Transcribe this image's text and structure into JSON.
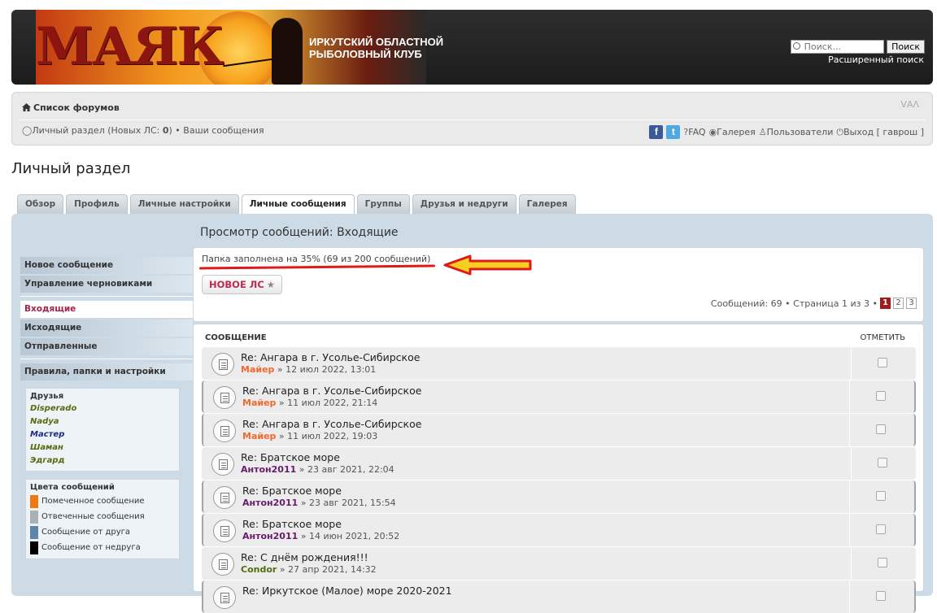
{
  "header": {
    "logo_text": "МАЯК",
    "club_line1": "Иркутский областной",
    "club_line2": "рыболовный клуб",
    "search_placeholder": "Поиск...",
    "search_button": "Поиск",
    "advanced_search": "Расширенный поиск"
  },
  "nav": {
    "forum_list": "Список форумов",
    "resize_icon": "ᐯAᐱ",
    "personal_section": "Личный раздел (Новых ЛС: ",
    "new_pm_count": "0",
    "personal_close": ")",
    "bullet": " • ",
    "your_posts": "Ваши сообщения",
    "faq": "FAQ",
    "gallery": "Галерея",
    "users": "Пользователи",
    "logout": "Выход [ гаврош ]",
    "facebook_glyph": "f",
    "twitter_glyph": "t"
  },
  "page": {
    "title": "Личный раздел",
    "tabs": [
      {
        "label": "Обзор",
        "active": false
      },
      {
        "label": "Профиль",
        "active": false
      },
      {
        "label": "Личные настройки",
        "active": false
      },
      {
        "label": "Личные сообщения",
        "active": true
      },
      {
        "label": "Группы",
        "active": false
      },
      {
        "label": "Друзья и недруги",
        "active": false
      },
      {
        "label": "Галерея",
        "active": false
      }
    ]
  },
  "sidebar": {
    "compose": "Новое сообщение",
    "drafts": "Управление черновиками",
    "inbox": "Входящие",
    "outbox": "Исходящие",
    "sent": "Отправленные",
    "rules": "Правила, папки и настройки",
    "friends_header": "Друзья",
    "friends": [
      {
        "name": "Disperado",
        "color": "#556b10"
      },
      {
        "name": "Nadya",
        "color": "#556b10"
      },
      {
        "name": "Мастер",
        "color": "#1a2a8a"
      },
      {
        "name": "Шаман",
        "color": "#556b10"
      },
      {
        "name": "Эдгард",
        "color": "#556b10"
      }
    ],
    "colors_header": "Цвета сообщений",
    "legend": [
      {
        "label": "Помеченное сообщение",
        "color": "#f07a12"
      },
      {
        "label": "Отвеченные сообщения",
        "color": "#a9b0b6"
      },
      {
        "label": "Сообщение от друга",
        "color": "#5d86aa"
      },
      {
        "label": "Сообщение от недруга",
        "color": "#000000"
      }
    ]
  },
  "content": {
    "view_title": "Просмотр сообщений: Входящие",
    "folder_status": "Папка заполнена на 35% (69 из 200 сообщений)",
    "folder_fill_percent": 35,
    "new_pm_button": "НОВОЕ ЛС",
    "new_pm_star": "★",
    "pagination_text": "Сообщений: 69 • Страница 1 из 3 •",
    "pages": [
      "1",
      "2",
      "3"
    ],
    "current_page": "1",
    "col_message": "СООБЩЕНИЕ",
    "col_mark": "ОТМЕТИТЬ",
    "messages": [
      {
        "subject": "Re: Ангара в г. Усолье-Сибирское",
        "author": "Майер",
        "author_color": "#f06a30",
        "date": "» 12 июл 2022, 13:01",
        "bordered": false
      },
      {
        "subject": "Re: Ангара в г. Усолье-Сибирское",
        "author": "Майер",
        "author_color": "#f06a30",
        "date": "» 11 июл 2022, 21:14",
        "bordered": true
      },
      {
        "subject": "Re: Ангара в г. Усолье-Сибирское",
        "author": "Майер",
        "author_color": "#f06a30",
        "date": "» 11 июл 2022, 19:03",
        "bordered": true
      },
      {
        "subject": "Re: Братское море",
        "author": "Антон2011",
        "author_color": "#6a1a6a",
        "date": "» 23 авг 2021, 22:04",
        "bordered": false
      },
      {
        "subject": "Re: Братское море",
        "author": "Антон2011",
        "author_color": "#6a1a6a",
        "date": "» 23 авг 2021, 15:54",
        "bordered": true
      },
      {
        "subject": "Re: Братское море",
        "author": "Антон2011",
        "author_color": "#6a1a6a",
        "date": "» 14 июн 2021, 20:52",
        "bordered": true
      },
      {
        "subject": "Re: С днём рождения!!!",
        "author": "Condor",
        "author_color": "#556b10",
        "date": "» 27 апр 2021, 14:32",
        "bordered": false
      },
      {
        "subject": "Re: Иркутское (Малое) море 2020-2021",
        "author": "",
        "author_color": "#555555",
        "date": "",
        "bordered": true
      }
    ]
  }
}
